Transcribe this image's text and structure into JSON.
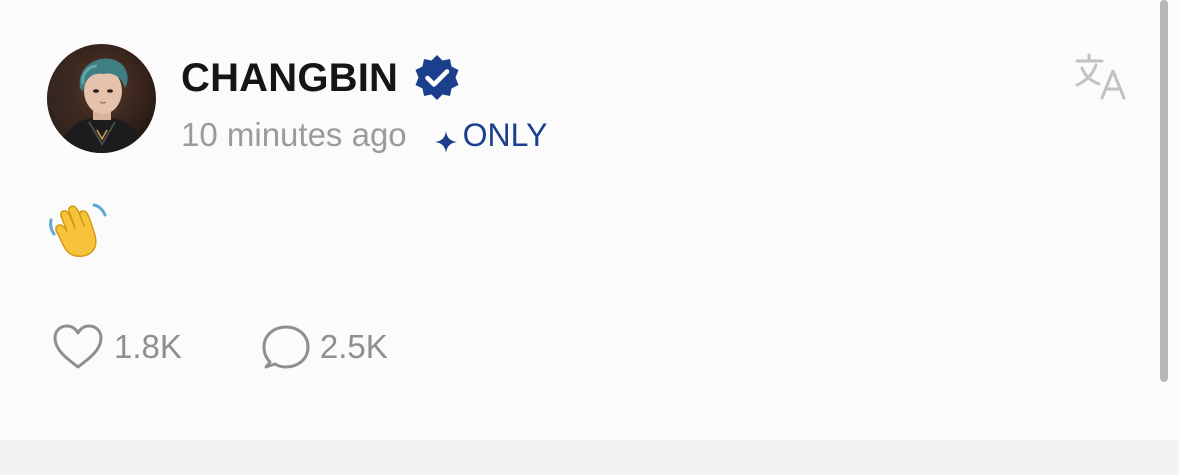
{
  "post": {
    "author": {
      "name": "CHANGBIN",
      "verified": true
    },
    "timestamp": "10 minutes ago",
    "visibility_badge": {
      "icon": "sparkle-icon",
      "label": "ONLY"
    },
    "content": {
      "emoji": "👋",
      "emoji_name": "waving-hand"
    },
    "stats": {
      "likes": "1.8K",
      "comments": "2.5K"
    },
    "icons": {
      "translate": "translate-icon",
      "like": "heart-icon",
      "comment": "comment-bubble-icon",
      "verified": "verified-badge-icon"
    }
  },
  "colors": {
    "background": "#fbfbfb",
    "name_text": "#151515",
    "muted_text": "#9b9b9b",
    "accent_blue": "#1b3f8c",
    "icon_gray": "#8f8f8f",
    "emoji_yellow": "#f6c33b"
  }
}
